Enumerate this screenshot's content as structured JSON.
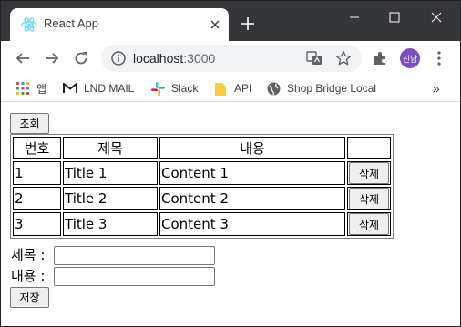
{
  "browser": {
    "tab_title": "React App",
    "url_host": "localhost",
    "url_port": ":3000",
    "profile_initials": "진남",
    "bookmarks": [
      {
        "label": "앱",
        "icon": "apps-grid-icon"
      },
      {
        "label": "LND MAIL",
        "icon": "gmail-icon"
      },
      {
        "label": "Slack",
        "icon": "slack-icon"
      },
      {
        "label": "API",
        "icon": "folder-icon"
      },
      {
        "label": "Shop Bridge Local",
        "icon": "globe-icon"
      }
    ],
    "more_bookmarks": "»",
    "colors": {
      "frame": "#35363a",
      "avatar": "#7c4dbd",
      "omnibox": "#f1f3f4"
    }
  },
  "page": {
    "query_button": "조회",
    "table": {
      "headers": [
        "번호",
        "제목",
        "내용",
        ""
      ],
      "rows": [
        {
          "id": "1",
          "title": "Title 1",
          "content": "Content 1",
          "action": "삭제"
        },
        {
          "id": "2",
          "title": "Title 2",
          "content": "Content 2",
          "action": "삭제"
        },
        {
          "id": "3",
          "title": "Title 3",
          "content": "Content 3",
          "action": "삭제"
        }
      ]
    },
    "form": {
      "title_label": "제목 :",
      "title_value": "",
      "content_label": "내용 :",
      "content_value": "",
      "save_button": "저장"
    }
  }
}
